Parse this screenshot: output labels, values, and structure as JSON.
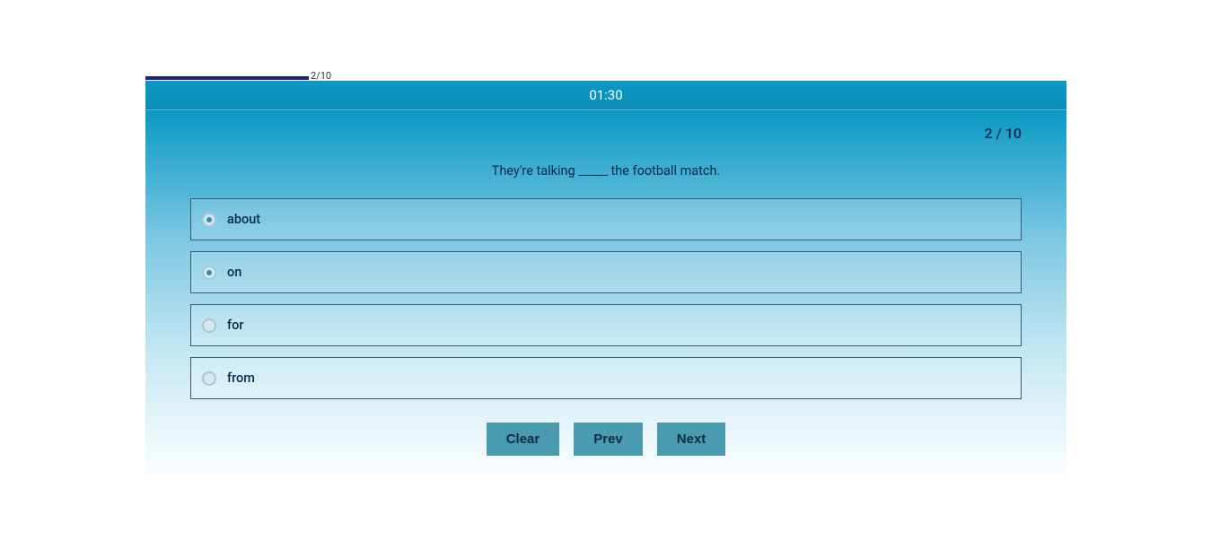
{
  "progress": {
    "label": "2/10"
  },
  "timer": "01:30",
  "counter": "2 / 10",
  "question": "They're talking _____ the football match.",
  "options": [
    {
      "label": "about",
      "selected": true
    },
    {
      "label": "on",
      "selected": true
    },
    {
      "label": "for",
      "selected": false
    },
    {
      "label": "from",
      "selected": false
    }
  ],
  "buttons": {
    "clear": "Clear",
    "prev": "Prev",
    "next": "Next"
  }
}
